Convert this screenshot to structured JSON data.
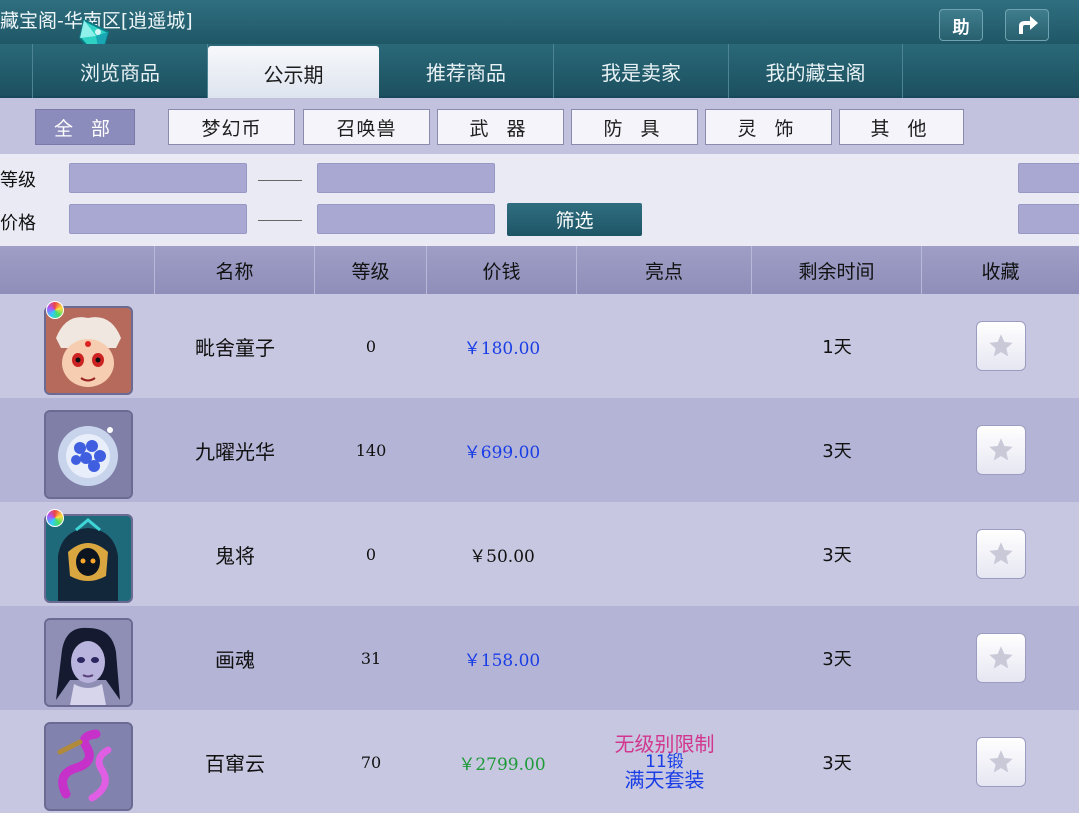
{
  "window": {
    "title": "藏宝阁-华南区[逍遥城]",
    "help_label": "助"
  },
  "tabs": [
    {
      "label": "浏览商品",
      "active": false
    },
    {
      "label": "公示期",
      "active": true
    },
    {
      "label": "推荐商品",
      "active": false
    },
    {
      "label": "我是卖家",
      "active": false
    },
    {
      "label": "我的藏宝阁",
      "active": false
    }
  ],
  "categories": [
    {
      "label": "全 部",
      "active": true
    },
    {
      "label": "梦幻币",
      "active": false
    },
    {
      "label": "召唤兽",
      "active": false
    },
    {
      "label": "武 器",
      "active": false
    },
    {
      "label": "防 具",
      "active": false
    },
    {
      "label": "灵 饰",
      "active": false
    },
    {
      "label": "其 他",
      "active": false
    }
  ],
  "filters": {
    "level_label": "等级",
    "price_label": "价格",
    "filter_button": "筛选"
  },
  "table": {
    "headers": [
      "名称",
      "等级",
      "价钱",
      "亮点",
      "剩余时间",
      "收藏"
    ],
    "rows": [
      {
        "name": "毗舍童子",
        "level": "0",
        "price": "￥180.00",
        "price_color": "#1a3ee6",
        "highlight": [],
        "time": "1天",
        "icon": "child-face-icon",
        "gem": true
      },
      {
        "name": "九曜光华",
        "level": "140",
        "price": "￥699.00",
        "price_color": "#1a3ee6",
        "highlight": [],
        "time": "3天",
        "icon": "crystal-orb-icon",
        "gem": false
      },
      {
        "name": "鬼将",
        "level": "0",
        "price": "￥50.00",
        "price_color": "#111111",
        "highlight": [],
        "time": "3天",
        "icon": "ghost-general-icon",
        "gem": true
      },
      {
        "name": "画魂",
        "level": "31",
        "price": "￥158.00",
        "price_color": "#1a3ee6",
        "highlight": [],
        "time": "3天",
        "icon": "painted-soul-icon",
        "gem": false
      },
      {
        "name": "百窜云",
        "level": "70",
        "price": "￥2799.00",
        "price_color": "#1f9a39",
        "highlight": [
          "无级别限制",
          "11锻",
          "满天套装"
        ],
        "time": "3天",
        "icon": "purple-cloud-icon",
        "gem": false
      }
    ]
  }
}
